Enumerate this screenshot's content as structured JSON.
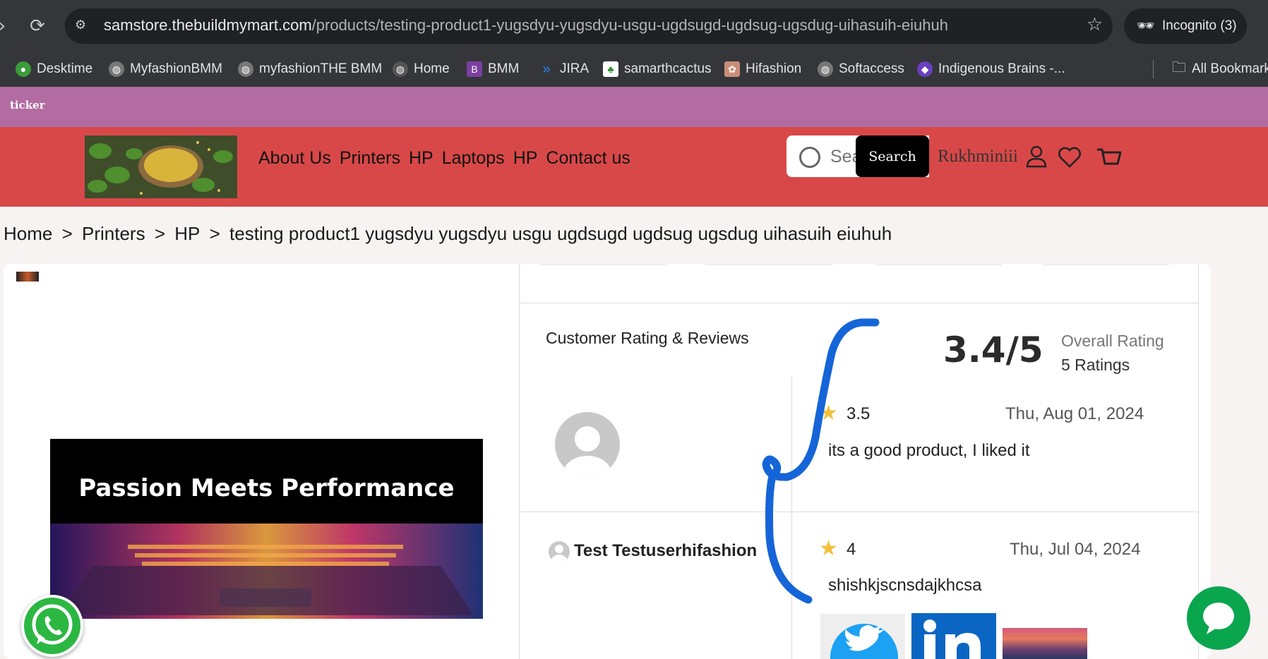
{
  "browser": {
    "url_host": "samstore.thebuildmymart.com",
    "url_path": "/products/testing-product1-yugsdyu-yugsdyu-usgu-ugdsugd-ugdsug-ugsdug-uihasuih-eiuhuh",
    "incognito_label": "Incognito (3)",
    "bookmarks": [
      {
        "label": "Desktime"
      },
      {
        "label": "MyfashionBMM"
      },
      {
        "label": "myfashionTHE BMM"
      },
      {
        "label": "Home"
      },
      {
        "label": "BMM"
      },
      {
        "label": "JIRA"
      },
      {
        "label": "samarthcactus"
      },
      {
        "label": "Hifashion"
      },
      {
        "label": "Softaccess"
      },
      {
        "label": "Indigenous Brains -..."
      }
    ],
    "all_bookmarks_label": "All Bookmarks"
  },
  "store": {
    "ticker": "ticker",
    "nav": [
      "About Us",
      "Printers",
      "HP",
      "Laptops",
      "HP",
      "Contact us"
    ],
    "search_placeholder": "Search",
    "search_button": "Search",
    "user_name": "Rukhminiii"
  },
  "breadcrumb": [
    "Home",
    ">",
    "Printers",
    ">",
    "HP",
    ">",
    "testing product1 yugsdyu yugsdyu usgu ugdsugd ugdsug ugsdug uihasuih eiuhuh"
  ],
  "product": {
    "banner_headline": "Passion Meets Performance"
  },
  "reviews": {
    "title": "Customer Rating & Reviews",
    "score": "3.4/5",
    "overall_label": "Overall Rating",
    "count_label": "5 Ratings",
    "items": [
      {
        "reviewer": "",
        "rating": "3.5",
        "date": "Thu, Aug 01, 2024",
        "text": "its a good product, I liked it"
      },
      {
        "reviewer": "Test Testuserhifashion",
        "rating": "4",
        "date": "Thu, Jul 04, 2024",
        "text": "shishkjscnsdajkhcsa"
      }
    ]
  },
  "colors": {
    "ticker_bg": "#b36ca2",
    "header_bg": "#d94848",
    "whatsapp": "#2cb742",
    "chat": "#0aa64e",
    "annotation_pen": "#1565d8"
  }
}
